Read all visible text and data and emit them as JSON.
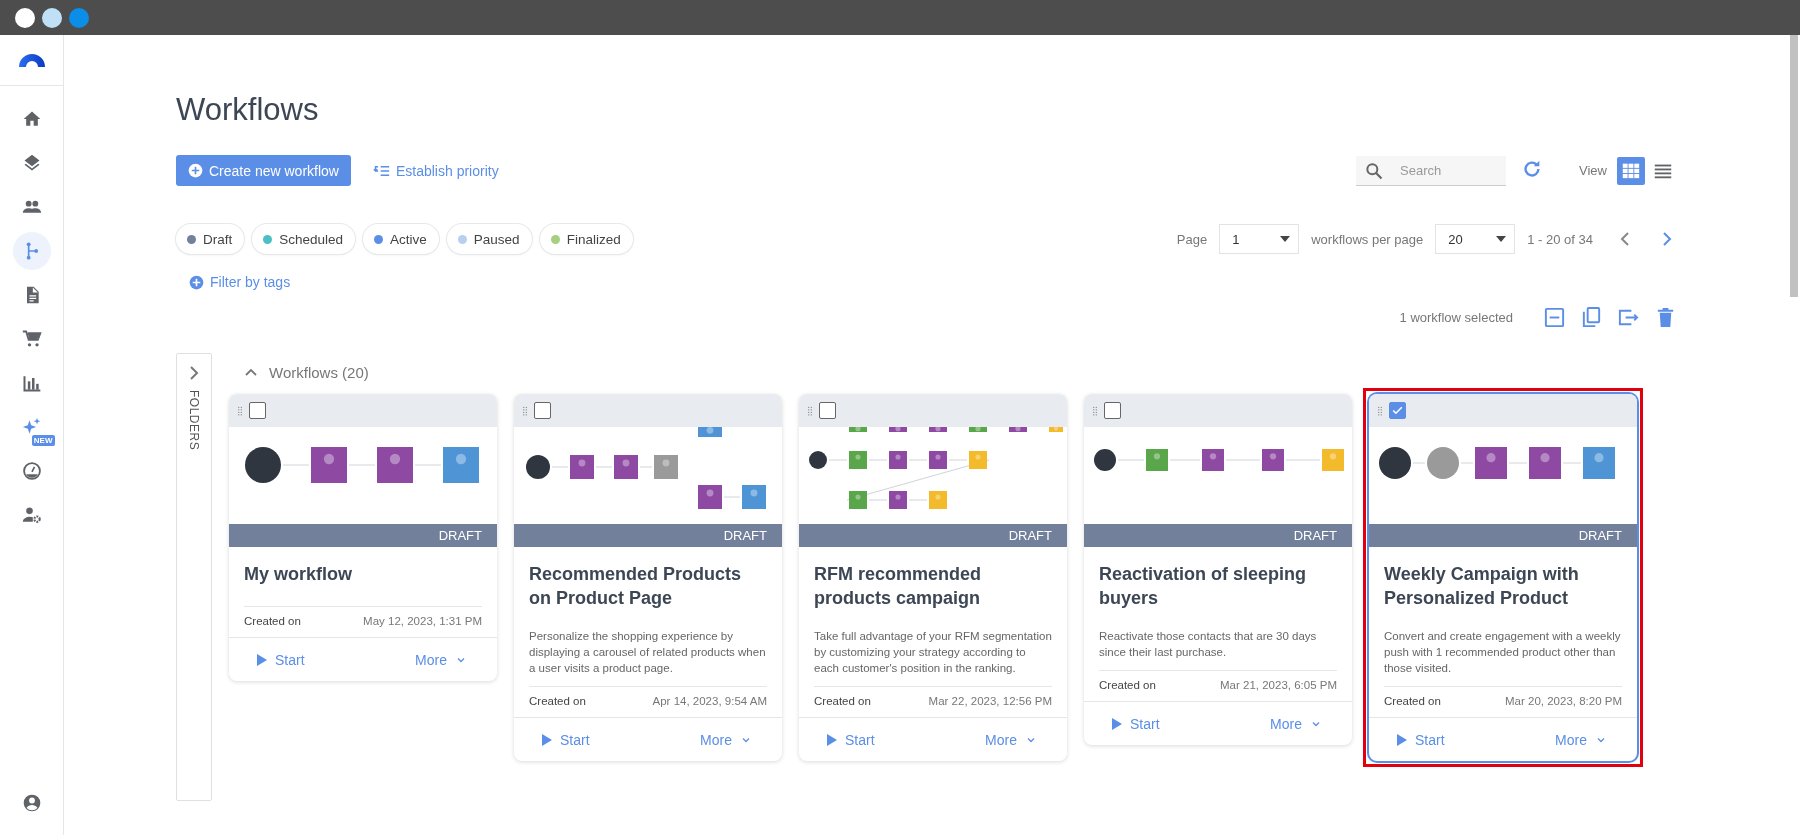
{
  "sidebar": {
    "items": [
      {
        "selected": false
      },
      {
        "selected": false
      },
      {
        "selected": false
      },
      {
        "selected": true
      },
      {
        "selected": false
      },
      {
        "selected": false
      },
      {
        "selected": false
      },
      {
        "selected": false,
        "badge": "NEW"
      },
      {
        "selected": false
      },
      {
        "selected": false
      }
    ]
  },
  "page_title": "Workflows",
  "actions": {
    "create": "Create new workflow",
    "priority": "Establish priority"
  },
  "search": {
    "placeholder": "Search"
  },
  "view": {
    "label": "View",
    "options": [
      {
        "selected": true
      },
      {
        "selected": false
      }
    ]
  },
  "status_filters": [
    {
      "label": "Draft",
      "color": "#72809b"
    },
    {
      "label": "Scheduled",
      "color": "#4bbfc4"
    },
    {
      "label": "Active",
      "color": "#5b8ee6"
    },
    {
      "label": "Paused",
      "color": "#b9cff2"
    },
    {
      "label": "Finalized",
      "color": "#a5d07f"
    }
  ],
  "filter_by_tags": "Filter by tags",
  "pagination": {
    "page_label": "Page",
    "page": "1",
    "per_page_label": "workflows per page",
    "per_page": "20",
    "range": "1 - 20 of 34"
  },
  "selection": {
    "text": "1 workflow selected"
  },
  "folders": {
    "label": "FOLDERS"
  },
  "group": {
    "title": "Workflows (20)"
  },
  "cards": [
    {
      "title": "My workflow",
      "status": "DRAFT",
      "created_label": "Created on",
      "created": "May 12, 2023, 1:31 PM",
      "start": "Start",
      "more": "More",
      "checked": false,
      "highlighted": false
    },
    {
      "title": "Recommended Products on Product Page",
      "description": "Personalize the shopping experience by displaying a carousel of related products when a user visits a product page.",
      "status": "DRAFT",
      "created_label": "Created on",
      "created": "Apr 14, 2023, 9:54 AM",
      "start": "Start",
      "more": "More",
      "checked": false,
      "highlighted": false
    },
    {
      "title": "RFM recommended products campaign",
      "description": "Take full advantage of your RFM segmentation by customizing your strategy according to each customer's position in the ranking.",
      "status": "DRAFT",
      "created_label": "Created on",
      "created": "Mar 22, 2023, 12:56 PM",
      "start": "Start",
      "more": "More",
      "checked": false,
      "highlighted": false
    },
    {
      "title": "Reactivation of sleeping buyers",
      "description": "Reactivate those contacts that are 30 days since their last purchase.",
      "status": "DRAFT",
      "created_label": "Created on",
      "created": "Mar 21, 2023, 6:05 PM",
      "start": "Start",
      "more": "More",
      "checked": false,
      "highlighted": false
    },
    {
      "title": "Weekly Campaign with Personalized Product",
      "description": "Convert and create engagement with a weekly push with 1 recommended product other than those visited.",
      "status": "DRAFT",
      "created_label": "Created on",
      "created": "Mar 20, 2023, 8:20 PM",
      "start": "Start",
      "more": "More",
      "checked": true,
      "highlighted": true
    }
  ]
}
